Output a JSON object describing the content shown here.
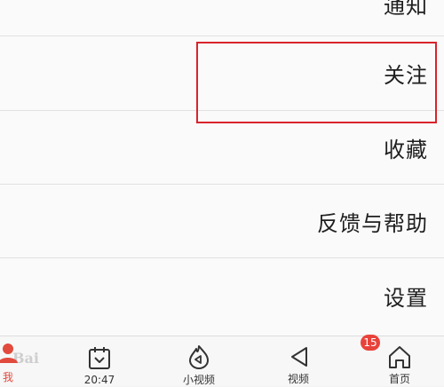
{
  "menu": {
    "items": [
      {
        "label": "通知"
      },
      {
        "label": "关注"
      },
      {
        "label": "收藏"
      },
      {
        "label": "反馈与帮助"
      },
      {
        "label": "设置"
      }
    ]
  },
  "tabbar": {
    "home_label": "首页",
    "home_badge": "15",
    "video_label": "视频",
    "mini_video_label": "小视频",
    "calendar_label": "20:47",
    "me_label": "我"
  },
  "watermark": {
    "text": "Bai"
  },
  "colors": {
    "highlight": "#d8242c",
    "badge": "#e8433b",
    "me_accent": "#e14a3d"
  },
  "icons": [
    "home-icon",
    "play-triangle-icon",
    "flame-play-icon",
    "calendar-icon",
    "user-icon"
  ]
}
